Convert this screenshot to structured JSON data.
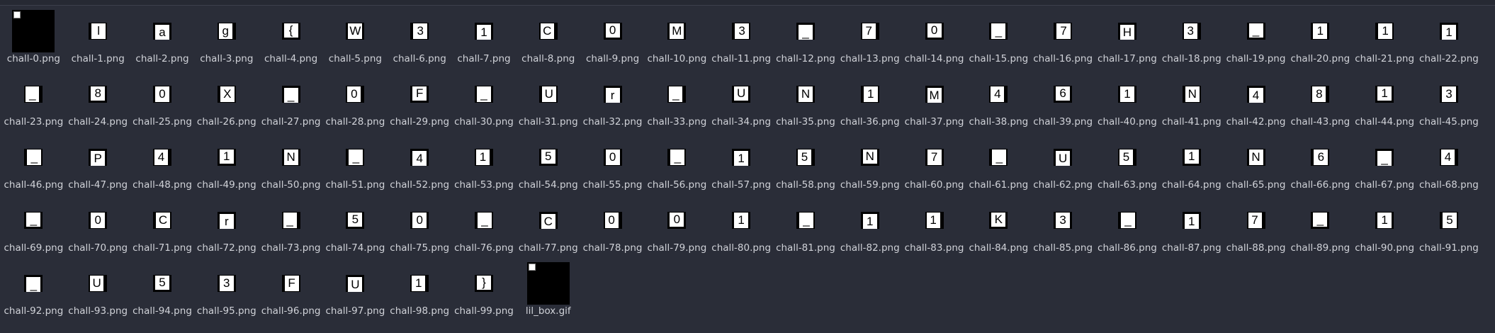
{
  "colors": {
    "background": "#2a2d38",
    "label": "#d0d2d8",
    "tile_bg": "#000000",
    "tile_fg": "#ffffff"
  },
  "files": [
    {
      "name": "chall-0.png",
      "kind": "box"
    },
    {
      "name": "chall-1.png",
      "char": "l"
    },
    {
      "name": "chall-2.png",
      "char": "a"
    },
    {
      "name": "chall-3.png",
      "char": "g"
    },
    {
      "name": "chall-4.png",
      "char": "{"
    },
    {
      "name": "chall-5.png",
      "char": "W"
    },
    {
      "name": "chall-6.png",
      "char": "3"
    },
    {
      "name": "chall-7.png",
      "char": "1"
    },
    {
      "name": "chall-8.png",
      "char": "C"
    },
    {
      "name": "chall-9.png",
      "char": "0"
    },
    {
      "name": "chall-10.png",
      "char": "M"
    },
    {
      "name": "chall-11.png",
      "char": "3"
    },
    {
      "name": "chall-12.png",
      "char": "_"
    },
    {
      "name": "chall-13.png",
      "char": "7"
    },
    {
      "name": "chall-14.png",
      "char": "0"
    },
    {
      "name": "chall-15.png",
      "char": "_"
    },
    {
      "name": "chall-16.png",
      "char": "7"
    },
    {
      "name": "chall-17.png",
      "char": "H"
    },
    {
      "name": "chall-18.png",
      "char": "3"
    },
    {
      "name": "chall-19.png",
      "char": "_"
    },
    {
      "name": "chall-20.png",
      "char": "1"
    },
    {
      "name": "chall-21.png",
      "char": "1"
    },
    {
      "name": "chall-22.png",
      "char": "1"
    },
    {
      "name": "chall-23.png",
      "char": "_"
    },
    {
      "name": "chall-24.png",
      "char": "8"
    },
    {
      "name": "chall-25.png",
      "char": "0"
    },
    {
      "name": "chall-26.png",
      "char": "X"
    },
    {
      "name": "chall-27.png",
      "char": "_"
    },
    {
      "name": "chall-28.png",
      "char": "0"
    },
    {
      "name": "chall-29.png",
      "char": "F"
    },
    {
      "name": "chall-30.png",
      "char": "_"
    },
    {
      "name": "chall-31.png",
      "char": "U"
    },
    {
      "name": "chall-32.png",
      "char": "r"
    },
    {
      "name": "chall-33.png",
      "char": "_"
    },
    {
      "name": "chall-34.png",
      "char": "U"
    },
    {
      "name": "chall-35.png",
      "char": "N"
    },
    {
      "name": "chall-36.png",
      "char": "1"
    },
    {
      "name": "chall-37.png",
      "char": "M"
    },
    {
      "name": "chall-38.png",
      "char": "4"
    },
    {
      "name": "chall-39.png",
      "char": "6"
    },
    {
      "name": "chall-40.png",
      "char": "1"
    },
    {
      "name": "chall-41.png",
      "char": "N"
    },
    {
      "name": "chall-42.png",
      "char": "4"
    },
    {
      "name": "chall-43.png",
      "char": "8"
    },
    {
      "name": "chall-44.png",
      "char": "1"
    },
    {
      "name": "chall-45.png",
      "char": "3"
    },
    {
      "name": "chall-46.png",
      "char": "_"
    },
    {
      "name": "chall-47.png",
      "char": "P"
    },
    {
      "name": "chall-48.png",
      "char": "4"
    },
    {
      "name": "chall-49.png",
      "char": "1"
    },
    {
      "name": "chall-50.png",
      "char": "N"
    },
    {
      "name": "chall-51.png",
      "char": "_"
    },
    {
      "name": "chall-52.png",
      "char": "4"
    },
    {
      "name": "chall-53.png",
      "char": "1"
    },
    {
      "name": "chall-54.png",
      "char": "5"
    },
    {
      "name": "chall-55.png",
      "char": "0"
    },
    {
      "name": "chall-56.png",
      "char": "_"
    },
    {
      "name": "chall-57.png",
      "char": "1"
    },
    {
      "name": "chall-58.png",
      "char": "5"
    },
    {
      "name": "chall-59.png",
      "char": "N"
    },
    {
      "name": "chall-60.png",
      "char": "7"
    },
    {
      "name": "chall-61.png",
      "char": "_"
    },
    {
      "name": "chall-62.png",
      "char": "U"
    },
    {
      "name": "chall-63.png",
      "char": "5"
    },
    {
      "name": "chall-64.png",
      "char": "1"
    },
    {
      "name": "chall-65.png",
      "char": "N"
    },
    {
      "name": "chall-66.png",
      "char": "6"
    },
    {
      "name": "chall-67.png",
      "char": "_"
    },
    {
      "name": "chall-68.png",
      "char": "4"
    },
    {
      "name": "chall-69.png",
      "char": "_"
    },
    {
      "name": "chall-70.png",
      "char": "0"
    },
    {
      "name": "chall-71.png",
      "char": "C"
    },
    {
      "name": "chall-72.png",
      "char": "r"
    },
    {
      "name": "chall-73.png",
      "char": "_"
    },
    {
      "name": "chall-74.png",
      "char": "5"
    },
    {
      "name": "chall-75.png",
      "char": "0"
    },
    {
      "name": "chall-76.png",
      "char": "_"
    },
    {
      "name": "chall-77.png",
      "char": "C"
    },
    {
      "name": "chall-78.png",
      "char": "0"
    },
    {
      "name": "chall-79.png",
      "char": "0"
    },
    {
      "name": "chall-80.png",
      "char": "1"
    },
    {
      "name": "chall-81.png",
      "char": "_"
    },
    {
      "name": "chall-82.png",
      "char": "1"
    },
    {
      "name": "chall-83.png",
      "char": "1"
    },
    {
      "name": "chall-84.png",
      "char": "K"
    },
    {
      "name": "chall-85.png",
      "char": "3"
    },
    {
      "name": "chall-86.png",
      "char": "_"
    },
    {
      "name": "chall-87.png",
      "char": "1"
    },
    {
      "name": "chall-88.png",
      "char": "7"
    },
    {
      "name": "chall-89.png",
      "char": "_"
    },
    {
      "name": "chall-90.png",
      "char": "1"
    },
    {
      "name": "chall-91.png",
      "char": "5"
    },
    {
      "name": "chall-92.png",
      "char": "_"
    },
    {
      "name": "chall-93.png",
      "char": "U"
    },
    {
      "name": "chall-94.png",
      "char": "5"
    },
    {
      "name": "chall-95.png",
      "char": "3"
    },
    {
      "name": "chall-96.png",
      "char": "F"
    },
    {
      "name": "chall-97.png",
      "char": "U"
    },
    {
      "name": "chall-98.png",
      "char": "1"
    },
    {
      "name": "chall-99.png",
      "char": "}"
    },
    {
      "name": "lil_box.gif",
      "kind": "box"
    }
  ]
}
